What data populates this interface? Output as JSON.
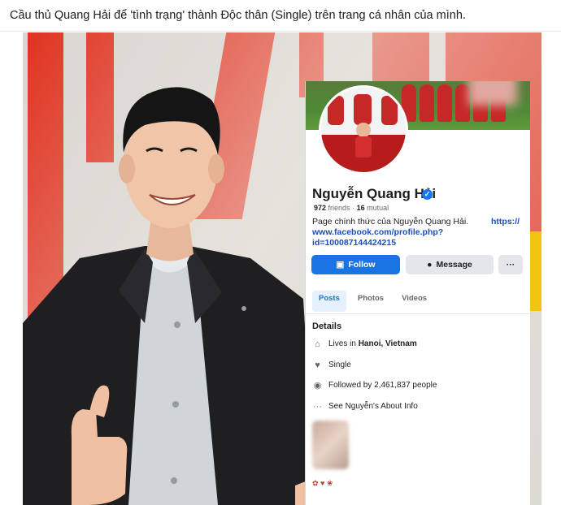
{
  "caption": "Cầu thủ Quang Hải để 'tình trạng' thành Độc thân (Single) trên trang cá nhân của mình.",
  "profile": {
    "name": "Nguyễn Quang Hải",
    "friends_count": "972",
    "friends_label": "friends",
    "mutual_count": "16",
    "mutual_label": "mutual",
    "bio_text": "Page chính thức của Nguyễn Quang Hải.",
    "bio_link_start": "https://",
    "bio_link": "www.facebook.com/profile.php?id=100087144424215",
    "follow_label": "Follow",
    "message_label": "Message",
    "more_label": "···"
  },
  "tabs": [
    {
      "label": "Posts",
      "active": true
    },
    {
      "label": "Photos",
      "active": false
    },
    {
      "label": "Videos",
      "active": false
    }
  ],
  "details": {
    "title": "Details",
    "rows": [
      {
        "icon": "home-icon",
        "prefix": "Lives in ",
        "value": "Hanoi, Vietnam"
      },
      {
        "icon": "heart-icon",
        "prefix": "",
        "value": "Single"
      },
      {
        "icon": "followers-icon",
        "prefix": "",
        "value": "Followed by 2,461,837 people"
      },
      {
        "icon": "more-icon",
        "prefix": "",
        "value": "See Nguyễn's About Info"
      }
    ]
  },
  "colors": {
    "facebook_blue": "#1b74e4",
    "link": "#1a4dbb",
    "jersey_red": "#c62828",
    "banner_red": "#e0321f"
  }
}
